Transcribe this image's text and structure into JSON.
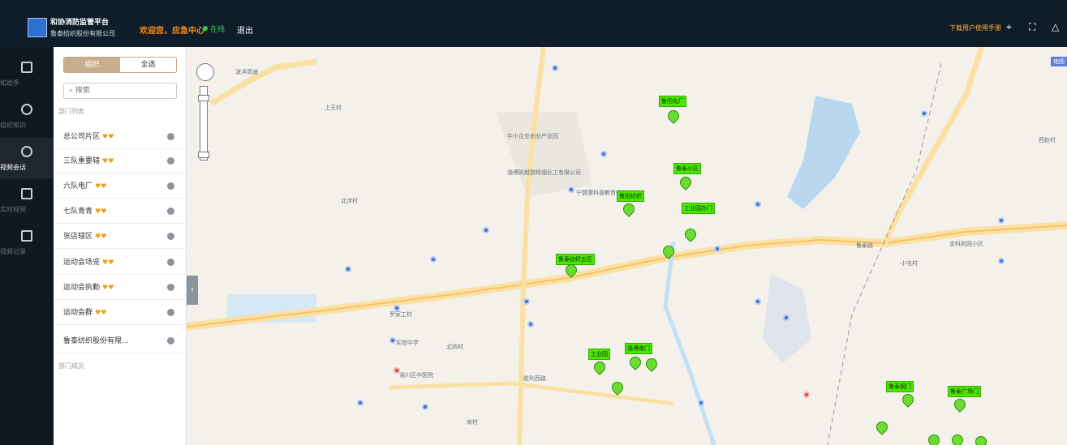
{
  "header": {
    "app_title": "和协消防监管平台",
    "company": "鲁泰纺织股份有限公司",
    "welcome": "欢迎您，应急中心",
    "status": "在线",
    "logout": "退出",
    "guide": "下载用户使用手册"
  },
  "nav": [
    {
      "label": "和助手",
      "icon": "calculator-icon"
    },
    {
      "label": "组织知识",
      "icon": "info-icon"
    },
    {
      "label": "视频会话",
      "icon": "chat-icon"
    },
    {
      "label": "实时视频",
      "icon": "play-icon"
    },
    {
      "label": "视频记录",
      "icon": "screen-icon"
    }
  ],
  "panel": {
    "tab_active": "组织",
    "tab_other": "全选",
    "search_placeholder": "搜索",
    "group1": "部门列表",
    "items": [
      "总公司片区",
      "三队重要辖",
      "六队电厂",
      "七队青青",
      "张店辖区",
      "运动会场览",
      "运动会执勤",
      "运动会群",
      "鲁泰纺织股份有限..."
    ],
    "group2": "部门成员"
  },
  "map_labels": {
    "east_road": "泼洋高速",
    "village1": "上王村",
    "place1": "中小企业创业产业园",
    "place2": "淄博凯越游精细化工有限公司",
    "place3": "宁健康科普教育中心",
    "place4": "北涉村",
    "station": "罗家工村",
    "road_main": "鲁泰路",
    "area_right": "金科和园小区",
    "school": "实验中学",
    "hospital": "淄川区中医院",
    "village2": "宋村",
    "village3": "北坊村",
    "village4": "小屯村",
    "area_bottom": "胜利西路",
    "marker_top": "鲁阳化厂",
    "marker_mid1": "鲁泰小区",
    "marker_mid2": "工业园办门",
    "marker_mid3": "鲁阳纺织",
    "marker_left": "鲁泰纺织五区",
    "marker_br1": "鲁泰钢门",
    "marker_br2": "鲁泰广场门",
    "marker_bl1": "工业园",
    "marker_bl2": "淄博南门",
    "right_edge": "西赵村"
  }
}
